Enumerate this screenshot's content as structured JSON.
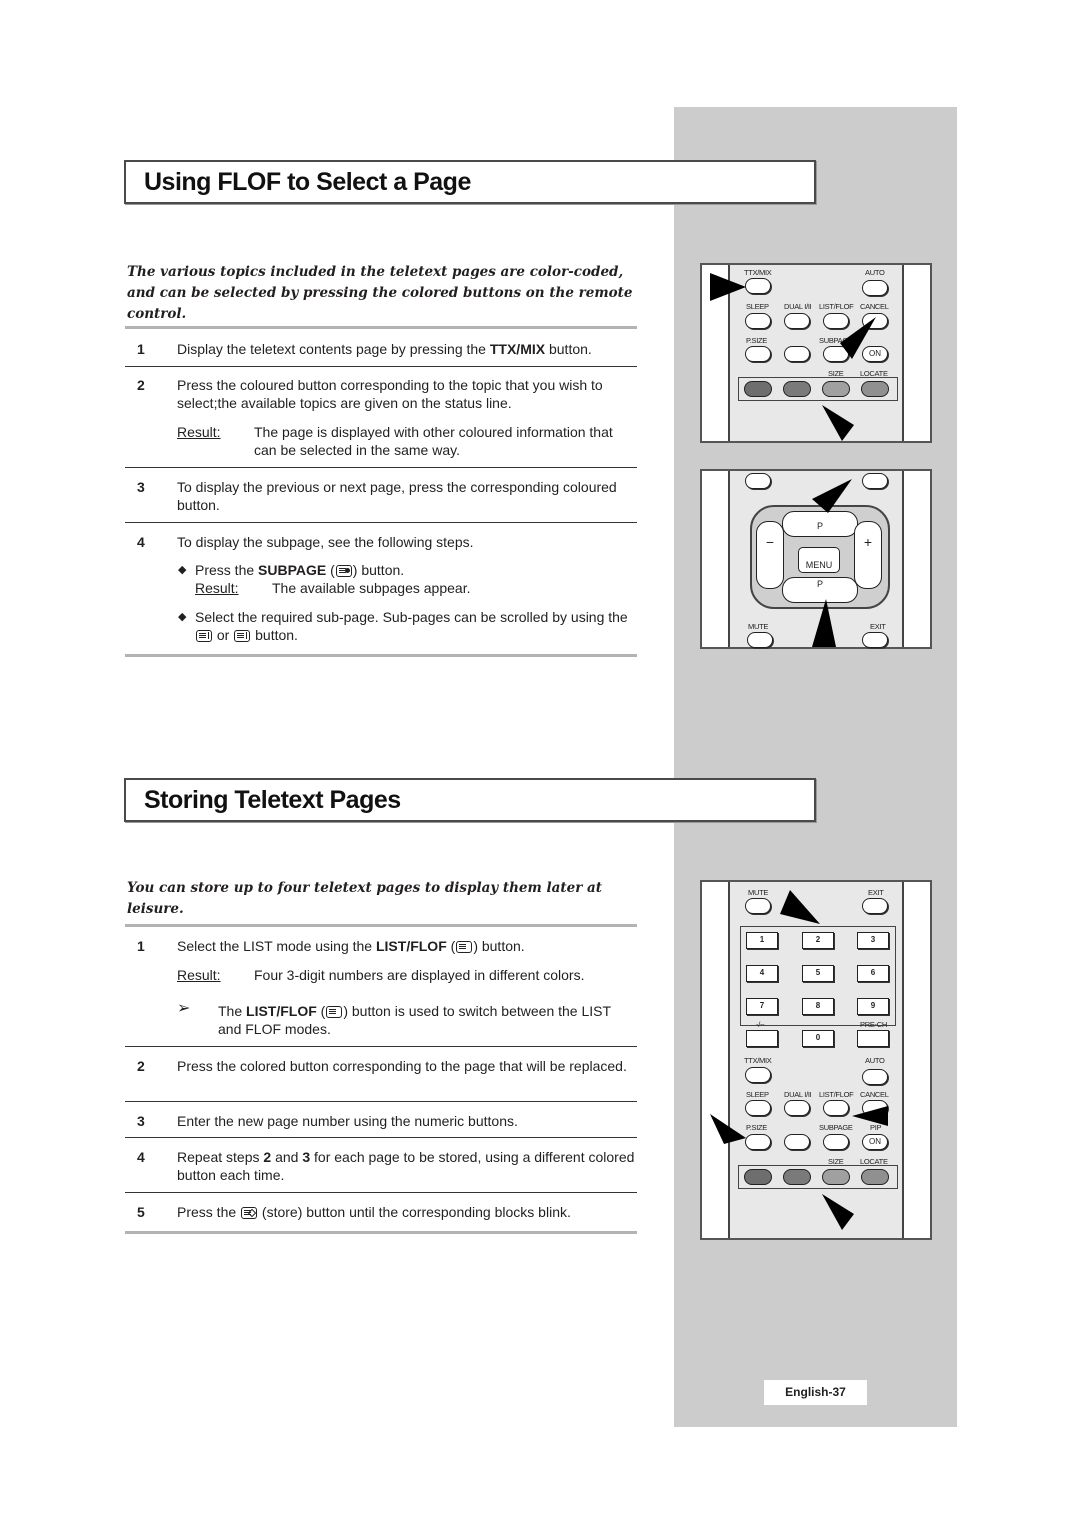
{
  "section1": {
    "title": "Using FLOF to Select a Page",
    "intro": "The various topics included in the teletext pages are color-coded, and can be selected by pressing the colored buttons on the remote control.",
    "steps": [
      {
        "num": "1",
        "text_before": "Display the teletext contents page by pressing the ",
        "bold": "TTX/MIX",
        "text_after": " button."
      },
      {
        "num": "2",
        "text": "Press the coloured button corresponding to the topic that you wish to select;the available topics are given on the status line.",
        "result_label": "Result:",
        "result_text": "The page is displayed with other coloured information that can be selected in the same way."
      },
      {
        "num": "3",
        "text": "To display the previous or next page, press the corresponding coloured button."
      },
      {
        "num": "4",
        "text": "To display the subpage, see the following steps.",
        "bullets": [
          {
            "text_before": "Press the ",
            "bold": "SUBPAGE",
            "paren_open": " (",
            "icon": "subpage-icon",
            "text_after": ") button.",
            "result_label": "Result:",
            "result_text": "The available subpages appear."
          },
          {
            "text_before": "Select the required sub-page. Sub-pages can be scrolled by using the ",
            "icon1": "page-down-icon",
            "middle": " or ",
            "icon2": "page-up-icon",
            "text_after": " button."
          }
        ]
      }
    ]
  },
  "section2": {
    "title": "Storing Teletext Pages",
    "intro": "You can store up to four teletext pages to display them later at leisure.",
    "steps": [
      {
        "num": "1",
        "text_before": "Select the LIST mode using the ",
        "bold": "LIST/FLOF",
        "paren_open": " (",
        "icon": "list-flof-icon",
        "text_after": ") button.",
        "result_label": "Result:",
        "result_text": "Four 3-digit numbers are displayed in different colors.",
        "note_before": "The ",
        "note_bold": "LIST/FLOF",
        "note_paren": " (",
        "note_after": ") button is used to switch between the LIST and FLOF modes."
      },
      {
        "num": "2",
        "text": "Press the colored button corresponding to the page that will be replaced."
      },
      {
        "num": "3",
        "text": "Enter the new page number using the numeric buttons."
      },
      {
        "num": "4",
        "text_before": "Repeat steps ",
        "bold1": "2",
        "middle": " and ",
        "bold2": "3",
        "text_after": " for each page to be stored, using a different colored button each time."
      },
      {
        "num": "5",
        "text_before": "Press the ",
        "icon": "store-icon",
        "text_after": " (store) button until the corresponding blocks blink."
      }
    ]
  },
  "remote1": {
    "labels": {
      "ttx_mix": "TTX/MIX",
      "auto": "AUTO",
      "sleep": "SLEEP",
      "dual": "DUAL I/II",
      "list_flof": "LIST/FLOF",
      "cancel": "CANCEL",
      "psize": "P.SIZE",
      "subpage": "SUBPAGE",
      "on": "ON",
      "size": "SIZE",
      "locate": "LOCATE"
    }
  },
  "remote2": {
    "labels": {
      "p_up": "P",
      "menu": "MENU",
      "p_down": "P",
      "minus": "−",
      "plus": "+",
      "mute": "MUTE",
      "exit": "EXIT"
    }
  },
  "remote3": {
    "labels": {
      "mute": "MUTE",
      "exit": "EXIT",
      "dash": "-/--",
      "prech": "PRE-CH",
      "ttx_mix": "TTX/MIX",
      "auto": "AUTO",
      "sleep": "SLEEP",
      "dual": "DUAL I/II",
      "list_flof": "LIST/FLOF",
      "cancel": "CANCEL",
      "psize": "P.SIZE",
      "subpage": "SUBPAGE",
      "pip": "PIP",
      "on": "ON",
      "size": "SIZE",
      "locate": "LOCATE"
    },
    "digits": [
      "1",
      "2",
      "3",
      "4",
      "5",
      "6",
      "7",
      "8",
      "9",
      "0"
    ]
  },
  "colors": {
    "red": "#6e6e6e",
    "green": "#7a7a7a",
    "yellow": "#a0a0a0",
    "blue": "#909090",
    "sidebar": "#cccccc"
  },
  "footer": {
    "page_label": "English-37"
  }
}
